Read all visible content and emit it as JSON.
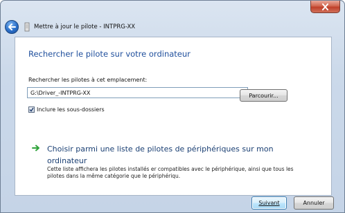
{
  "window": {
    "title": "Mettre à jour le pilote - INTPRG-XX",
    "close_icon": "close-icon",
    "back_icon": "back-arrow-icon",
    "title_icon": "wizard-icon"
  },
  "main": {
    "heading": "Rechercher le pilote sur votre ordinateur",
    "search_label": "Rechercher les pilotes à cet emplacement:",
    "path_value": "G:\\Driver_-INTPRG-XX",
    "browse_label": "Parcourir...",
    "include_subfolders_label": "Inclure les sous-dossiers",
    "include_subfolders_checked": true,
    "choose_title": "Choisir parmi une liste de pilotes de périphériques sur mon ordinateur",
    "choose_desc": "Cette liste affichera les pilotes installés er compatibles avec le périphérique, ainsi que tous les pilotes dans la même catégorie que le périphériqu."
  },
  "footer": {
    "next_label": "Suivant",
    "cancel_label": "Annuler"
  },
  "colors": {
    "heading": "#1e4e9c",
    "link": "#1a3f73",
    "arrow_green": "#2fa33a"
  }
}
